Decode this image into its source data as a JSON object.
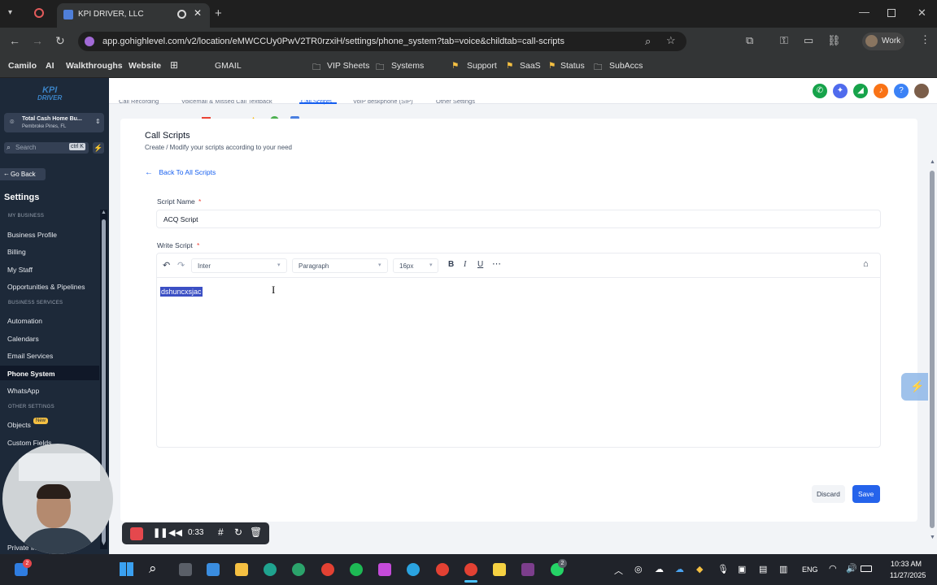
{
  "browser": {
    "tab_title": "KPI DRIVER, LLC",
    "url": "app.gohighlevel.com/v2/location/eMWCCUy0PwV2TR0rzxiH/settings/phone_system?tab=voice&childtab=call-scripts",
    "profile_label": "Work",
    "bookmarks": [
      "Camilo",
      "AI",
      "Walkthroughs",
      "Website",
      "GMAIL",
      "VIP Sheets",
      "Systems",
      "Support",
      "SaaS",
      "Status",
      "SubAccs"
    ]
  },
  "sidebar": {
    "logo_text_top": "KPI",
    "logo_text_bottom": "DRIVER",
    "account_name": "Total Cash Home Bu...",
    "account_location": "Pembroke Pines, FL",
    "search_placeholder": "Search",
    "search_shortcut": "ctrl K",
    "go_back": "Go Back",
    "settings_title": "Settings",
    "section_my_business": "MY BUSINESS",
    "items_my_business": [
      "Business Profile",
      "Billing",
      "My Staff",
      "Opportunities & Pipelines"
    ],
    "section_business_services": "BUSINESS SERVICES",
    "items_business_services": [
      "Automation",
      "Calendars",
      "Email Services",
      "Phone System",
      "WhatsApp"
    ],
    "section_other_settings": "OTHER SETTINGS",
    "objects_label": "Objects",
    "new_badge": "New",
    "custom_fields_label": "Custom Fields",
    "private_integrations": "Private Integ..."
  },
  "subtabs": [
    "Call Recording",
    "Voicemail & Missed Call Textback",
    "Call Scripts",
    "VoIP deskphone (SIP)",
    "Other Settings"
  ],
  "page": {
    "title": "Call Scripts",
    "subtitle": "Create / Modify your scripts according to your need",
    "back_link": "Back To All Scripts",
    "script_name_label": "Script Name",
    "required_mark": "*",
    "script_name_value": "ACQ Script",
    "write_script_label": "Write Script",
    "font_select": "Inter",
    "block_select": "Paragraph",
    "size_select": "16px",
    "editor_text": "dshuncxsjac",
    "discard_label": "Discard",
    "save_label": "Save"
  },
  "recorder": {
    "time": "0:33"
  },
  "taskbar": {
    "start_badge": "2",
    "whatsapp_badge": "2",
    "language": "ENG",
    "time": "10:33 AM",
    "date": "11/27/2025"
  },
  "colors": {
    "sidebar_bg": "#1d2939",
    "accent_blue": "#155eef",
    "save_button": "#2563eb",
    "selection": "#3b4fc4"
  }
}
